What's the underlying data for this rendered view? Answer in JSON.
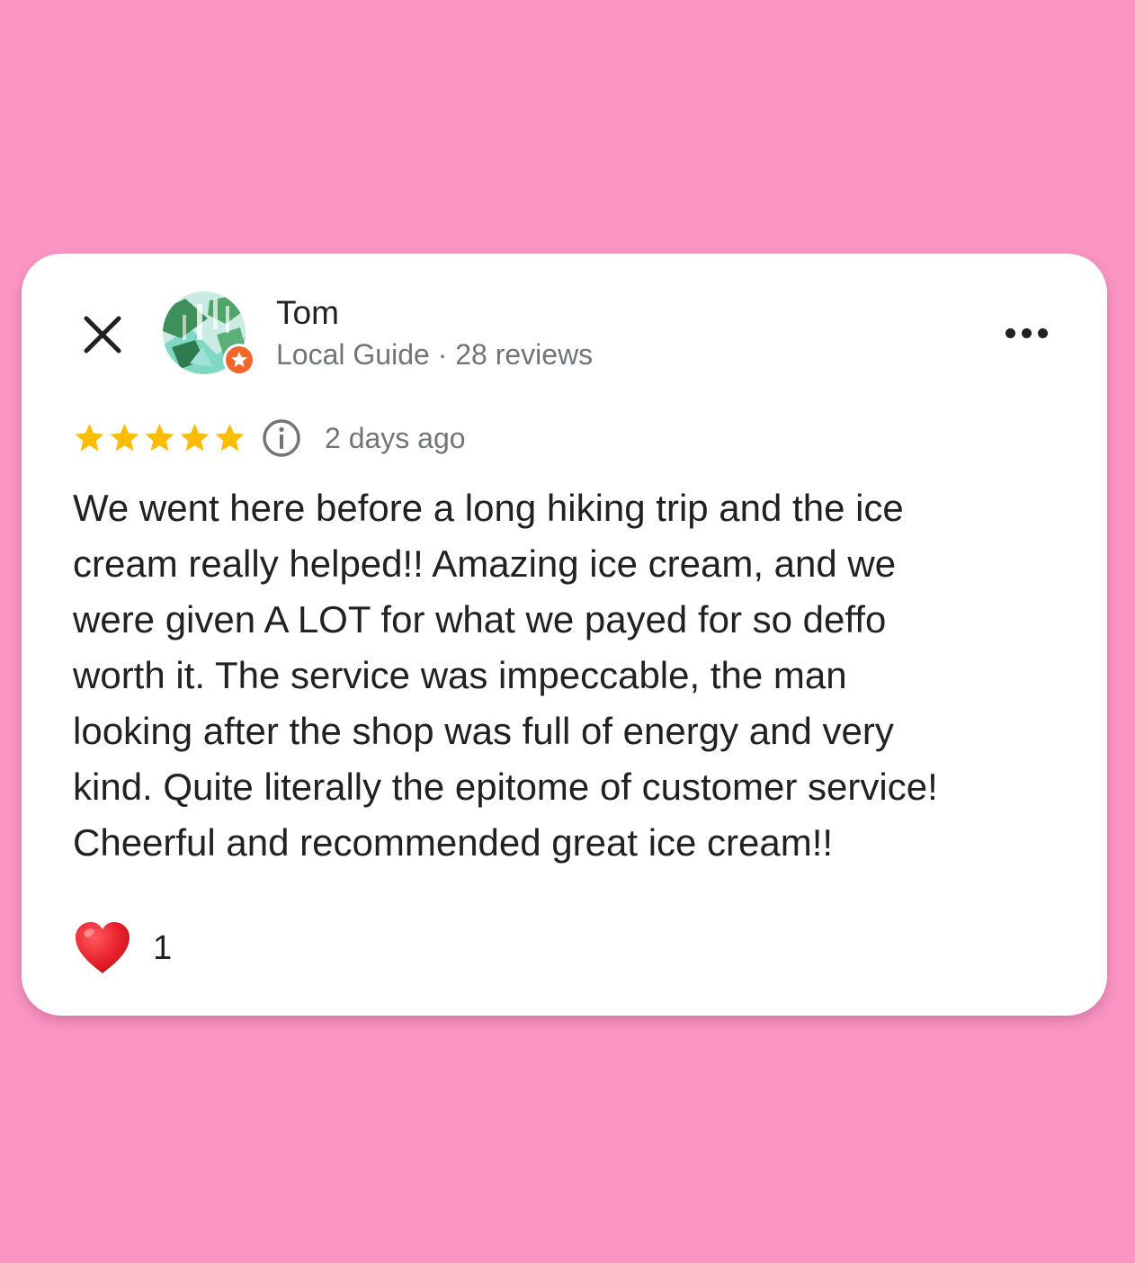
{
  "colors": {
    "background": "#fb96c4",
    "card": "#ffffff",
    "star": "#fbbc04",
    "badge": "#f2662a",
    "heart": "#e8202a",
    "text_primary": "#202124",
    "text_secondary": "#70757a"
  },
  "header": {
    "close_icon": "close-icon",
    "more_icon": "more-horizontal-icon"
  },
  "reviewer": {
    "name": "Tom",
    "meta": "Local Guide · 28 reviews",
    "badge_icon": "local-guide-star-badge"
  },
  "review": {
    "rating": 5,
    "rating_max": 5,
    "date": "2 days ago",
    "info_icon": "info-icon",
    "text_lines": [
      "We went here before a long hiking trip and the ice",
      "cream really helped!! Amazing ice cream, and we",
      "were given A LOT for what we payed for so deffo",
      "worth it. The service was impeccable, the man",
      "looking after the shop was full of energy and very",
      "kind. Quite literally the epitome of customer service!",
      "Cheerful and recommended great ice cream!!"
    ]
  },
  "reactions": {
    "icon": "red-heart-icon",
    "count": "1"
  }
}
